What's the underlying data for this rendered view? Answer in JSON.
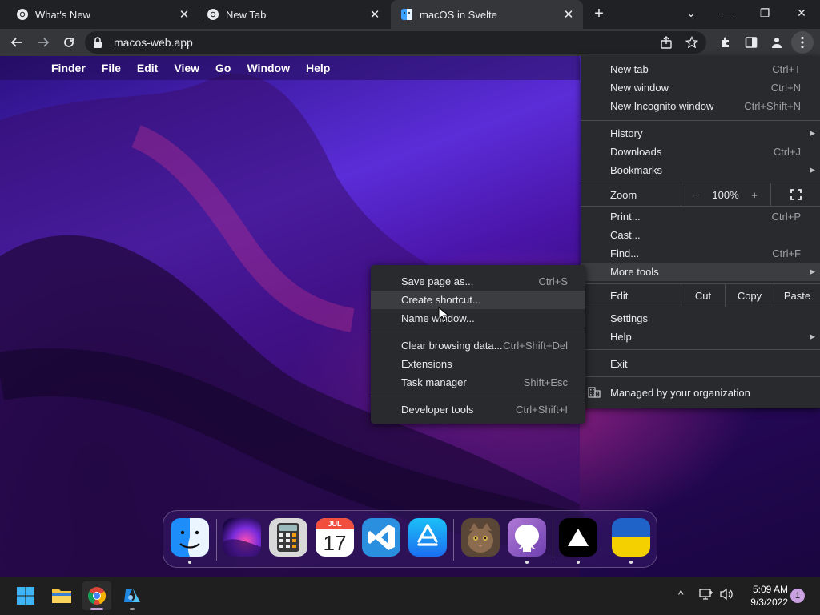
{
  "browser": {
    "tabs": [
      {
        "title": "What's New",
        "icon": "chrome-icon",
        "active": false
      },
      {
        "title": "New Tab",
        "icon": "chrome-icon",
        "active": false
      },
      {
        "title": "macOS in Svelte",
        "icon": "finder-favicon",
        "active": true
      }
    ],
    "new_tab_symbol": "+",
    "window_controls": {
      "tab_search": "⌄",
      "minimize": "—",
      "restore": "❐",
      "close": "✕"
    },
    "address": "macos-web.app"
  },
  "macos": {
    "apple_symbol": "",
    "menu": [
      "Finder",
      "File",
      "Edit",
      "View",
      "Go",
      "Window",
      "Help"
    ],
    "dock": {
      "items": [
        {
          "name": "Finder",
          "icon": "finder-icon",
          "running": true
        },
        {
          "name": "Wallpapers",
          "icon": "wallpapers-icon",
          "running": false
        },
        {
          "name": "Calculator",
          "icon": "calculator-icon",
          "running": false
        },
        {
          "name": "Calendar",
          "icon": "calendar-icon",
          "running": false,
          "month": "JUL",
          "day": "17"
        },
        {
          "name": "VS Code",
          "icon": "vscode-icon",
          "running": false
        },
        {
          "name": "App Store",
          "icon": "app-store-icon",
          "running": false
        },
        {
          "name": "Cat photo",
          "icon": "cat-photo-icon",
          "running": false
        },
        {
          "name": "GitHub",
          "icon": "github-icon",
          "running": true
        },
        {
          "name": "Vercel",
          "icon": "vercel-icon",
          "running": true
        },
        {
          "name": "Ukraine",
          "icon": "ukraine-flag-icon",
          "running": true
        }
      ]
    }
  },
  "chrome_menu": {
    "new_tab": {
      "label": "New tab",
      "shortcut": "Ctrl+T"
    },
    "new_window": {
      "label": "New window",
      "shortcut": "Ctrl+N"
    },
    "new_incognito": {
      "label": "New Incognito window",
      "shortcut": "Ctrl+Shift+N"
    },
    "history": {
      "label": "History"
    },
    "downloads": {
      "label": "Downloads",
      "shortcut": "Ctrl+J"
    },
    "bookmarks": {
      "label": "Bookmarks"
    },
    "zoom": {
      "label": "Zoom",
      "minus": "−",
      "level": "100%",
      "plus": "+"
    },
    "print": {
      "label": "Print...",
      "shortcut": "Ctrl+P"
    },
    "cast": {
      "label": "Cast..."
    },
    "find": {
      "label": "Find...",
      "shortcut": "Ctrl+F"
    },
    "more_tools": {
      "label": "More tools"
    },
    "edit": {
      "label": "Edit",
      "cut": "Cut",
      "copy": "Copy",
      "paste": "Paste"
    },
    "settings": {
      "label": "Settings"
    },
    "help": {
      "label": "Help"
    },
    "exit": {
      "label": "Exit"
    },
    "managed": {
      "label": "Managed by your organization"
    },
    "submenu_arrow": "▶"
  },
  "more_tools_menu": {
    "save_page": {
      "label": "Save page as...",
      "shortcut": "Ctrl+S"
    },
    "create_shortcut": {
      "label": "Create shortcut..."
    },
    "name_window": {
      "label": "Name window..."
    },
    "clear_data": {
      "label": "Clear browsing data...",
      "shortcut": "Ctrl+Shift+Del"
    },
    "extensions": {
      "label": "Extensions"
    },
    "task_manager": {
      "label": "Task manager",
      "shortcut": "Shift+Esc"
    },
    "dev_tools": {
      "label": "Developer tools",
      "shortcut": "Ctrl+Shift+I"
    }
  },
  "taskbar": {
    "apps": [
      {
        "name": "Start",
        "icon": "windows-start-icon"
      },
      {
        "name": "File Explorer",
        "icon": "file-explorer-icon"
      },
      {
        "name": "Google Chrome",
        "icon": "chrome-icon",
        "active": true
      },
      {
        "name": "Azure app",
        "icon": "azure-icon"
      }
    ],
    "tray": {
      "chevron": "^"
    },
    "time": "5:09 AM",
    "date": "9/3/2022",
    "notifications": "1"
  },
  "colors": {
    "chrome_dark": "#202124",
    "chrome_toolbar": "#35363a",
    "menu_bg": "#292a2d",
    "menu_highlight": "#3c3d41",
    "wallpaper_purple": "#5b2dd8",
    "wallpaper_pink": "#ff3caa"
  }
}
